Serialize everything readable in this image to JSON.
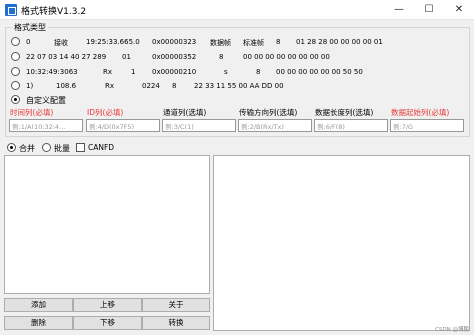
{
  "window": {
    "title": "格式转换V1.3.2",
    "minimize": "—",
    "maximize": "☐",
    "close": "✕"
  },
  "format_group": {
    "title": "格式类型",
    "rows": [
      [
        "0",
        "接收",
        "19:25:33.665.0",
        "0x00000323",
        "数据帧",
        "标准帧",
        "8",
        "01 28 28 00 00 00 00 01"
      ],
      [
        "22 07 03 14 40 27 289",
        "01",
        "0x00000352",
        "8",
        "00 00 00 00 00 00 00 00"
      ],
      [
        "10:32:49:3063",
        "Rx",
        "1",
        "0x00000210",
        "s",
        "8",
        "00 00 00 00 00 00 50 50"
      ],
      [
        "1)",
        "108.6",
        "Rx",
        "0224",
        "8",
        "22 33 11 55 00 AA DD 00"
      ]
    ],
    "custom_label": "自定义配置",
    "selected": "custom",
    "columns": [
      {
        "label": "时间列(必填)",
        "placeholder": "例:1/A(10:32:4…"
      },
      {
        "label": "ID列(必填)",
        "placeholder": "例:4/D(0x7F5)"
      },
      {
        "label": "通道列(选填)",
        "placeholder": "例:3/C(1)"
      },
      {
        "label": "传输方向列(选填)",
        "placeholder": "例:2/B(Rx/Tx)"
      },
      {
        "label": "数据长度列(选填)",
        "placeholder": "例:6/F(8)"
      },
      {
        "label": "数据起始列(必填)",
        "placeholder": "例:7/G"
      }
    ]
  },
  "mode": {
    "merge": "合并",
    "batch": "批量",
    "canfd": "CANFD",
    "selected": "merge",
    "canfd_checked": false
  },
  "buttons": {
    "add": "添加",
    "move_up": "上移",
    "about": "关于",
    "delete": "删除",
    "move_down": "下移",
    "convert": "转换"
  },
  "colors": {
    "required_label": "#e53935"
  },
  "watermark": "CSDN @博鹏"
}
